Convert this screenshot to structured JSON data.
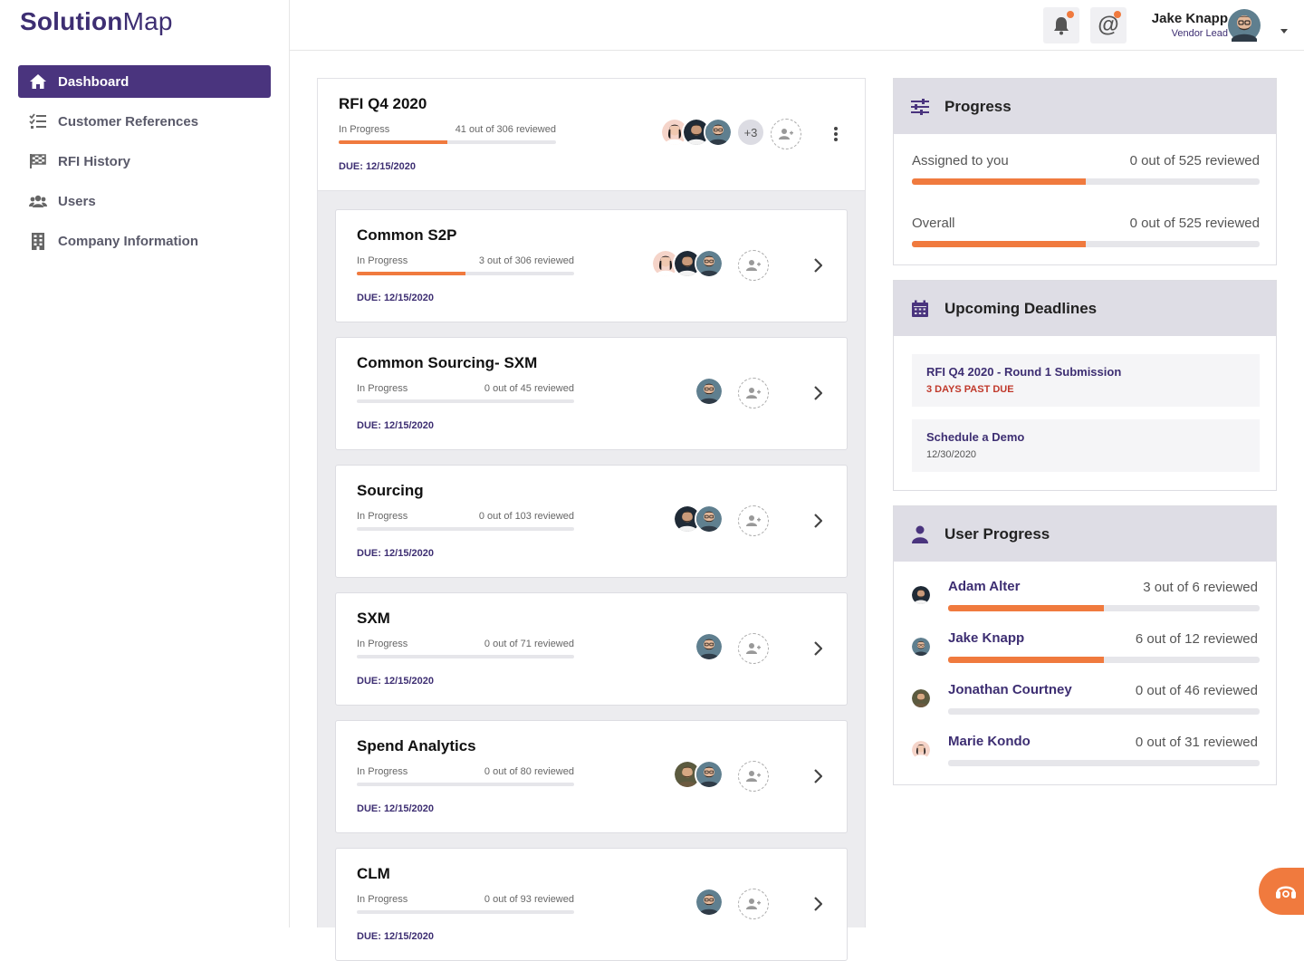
{
  "app": {
    "logo_bold": "Solution",
    "logo_light": "Map"
  },
  "nav": [
    {
      "label": "Dashboard",
      "icon": "home-icon",
      "active": true
    },
    {
      "label": "Customer References",
      "icon": "checklist-icon",
      "active": false
    },
    {
      "label": "RFI History",
      "icon": "flag-icon",
      "active": false
    },
    {
      "label": "Users",
      "icon": "users-icon",
      "active": false
    },
    {
      "label": "Company Information",
      "icon": "building-icon",
      "active": false
    }
  ],
  "header": {
    "user_name": "Jake Knapp",
    "user_role": "Vendor Lead"
  },
  "rfi": {
    "title": "RFI Q4 2020",
    "status": "In Progress",
    "reviewed": "41 out of 306 reviewed",
    "progress": 0.5,
    "due": "DUE: 12/15/2020",
    "extra_count": "+3"
  },
  "sections": [
    {
      "title": "Common S2P",
      "status": "In Progress",
      "reviewed": "3 out of 306 reviewed",
      "progress": 0.5,
      "due": "DUE: 12/15/2020",
      "avatars": [
        "marie",
        "adam",
        "jake"
      ]
    },
    {
      "title": "Common Sourcing- SXM",
      "status": "In Progress",
      "reviewed": "0 out of 45 reviewed",
      "progress": 0,
      "due": "DUE: 12/15/2020",
      "avatars": [
        "jake"
      ]
    },
    {
      "title": "Sourcing",
      "status": "In Progress",
      "reviewed": "0 out of 103 reviewed",
      "progress": 0,
      "due": "DUE: 12/15/2020",
      "avatars": [
        "adam",
        "jake"
      ]
    },
    {
      "title": "SXM",
      "status": "In Progress",
      "reviewed": "0 out of 71 reviewed",
      "progress": 0,
      "due": "DUE: 12/15/2020",
      "avatars": [
        "jake"
      ]
    },
    {
      "title": "Spend Analytics",
      "status": "In Progress",
      "reviewed": "0 out of 80 reviewed",
      "progress": 0,
      "due": "DUE: 12/15/2020",
      "avatars": [
        "jonathan",
        "jake"
      ]
    },
    {
      "title": "CLM",
      "status": "In Progress",
      "reviewed": "0 out of 93 reviewed",
      "progress": 0,
      "due": "DUE: 12/15/2020",
      "avatars": [
        "jake"
      ]
    }
  ],
  "progress_panel": {
    "title": "Progress",
    "rows": [
      {
        "label": "Assigned to you",
        "value": "0 out of 525 reviewed",
        "progress": 0.5
      },
      {
        "label": "Overall",
        "value": "0 out of 525 reviewed",
        "progress": 0.5
      }
    ]
  },
  "deadlines_panel": {
    "title": "Upcoming Deadlines",
    "items": [
      {
        "title": "RFI Q4 2020 - Round 1 Submission",
        "sub": "3 DAYS PAST DUE",
        "sub_color": "#c0392b"
      },
      {
        "title": "Schedule a Demo",
        "sub": "12/30/2020",
        "sub_color": "#555555"
      }
    ]
  },
  "user_progress_panel": {
    "title": "User Progress",
    "users": [
      {
        "name": "Adam Alter",
        "value": "3 out of 6 reviewed",
        "progress": 0.5,
        "avatar": "adam"
      },
      {
        "name": "Jake Knapp",
        "value": "6 out of 12 reviewed",
        "progress": 0.5,
        "avatar": "jake"
      },
      {
        "name": "Jonathan Courtney",
        "value": "0 out of 46 reviewed",
        "progress": 0,
        "avatar": "jonathan"
      },
      {
        "name": "Marie Kondo",
        "value": "0 out of 31 reviewed",
        "progress": 0,
        "avatar": "marie"
      }
    ]
  },
  "colors": {
    "brand": "#4a347e",
    "accent": "#f07a3e",
    "danger": "#c0392b"
  }
}
